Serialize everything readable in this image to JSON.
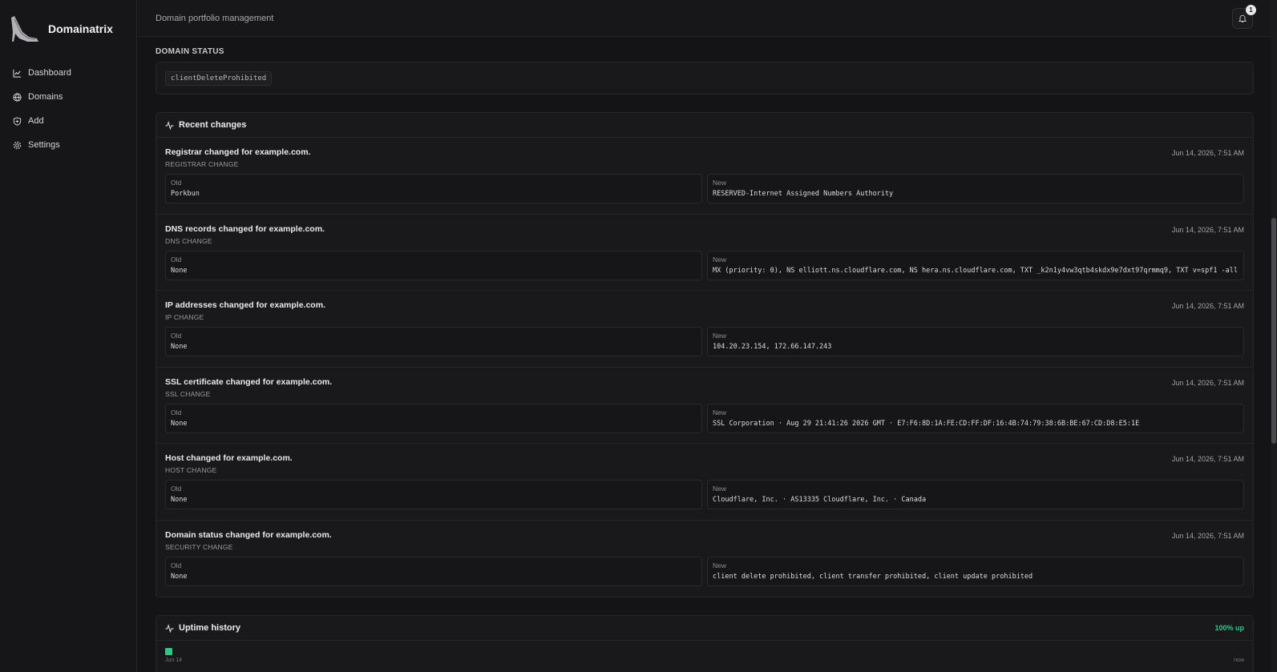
{
  "app": {
    "name": "Domainatrix"
  },
  "sidebar": {
    "items": [
      {
        "label": "Dashboard",
        "icon": "chart-line-icon"
      },
      {
        "label": "Domains",
        "icon": "globe-icon"
      },
      {
        "label": "Add",
        "icon": "shield-plus-icon"
      },
      {
        "label": "Settings",
        "icon": "gear-icon"
      }
    ]
  },
  "header": {
    "title": "Domain portfolio management",
    "notifications_count": "1"
  },
  "domain_status": {
    "heading": "DOMAIN STATUS",
    "chip": "clientDeleteProhibited"
  },
  "recent_changes": {
    "title": "Recent changes",
    "old_label": "Old",
    "new_label": "New",
    "items": [
      {
        "title": "Registrar changed for example.com.",
        "type": "REGISTRAR CHANGE",
        "time": "Jun 14, 2026, 7:51 AM",
        "old": "Porkbun",
        "new": "RESERVED-Internet Assigned Numbers Authority"
      },
      {
        "title": "DNS records changed for example.com.",
        "type": "DNS CHANGE",
        "time": "Jun 14, 2026, 7:51 AM",
        "old": "None",
        "new": "MX (priority: 0), NS elliott.ns.cloudflare.com, NS hera.ns.cloudflare.com, TXT _k2n1y4vw3qtb4skdx9e7dxt97qrmmq9, TXT v=spf1 -all"
      },
      {
        "title": "IP addresses changed for example.com.",
        "type": "IP CHANGE",
        "time": "Jun 14, 2026, 7:51 AM",
        "old": "None",
        "new": "104.20.23.154, 172.66.147.243"
      },
      {
        "title": "SSL certificate changed for example.com.",
        "type": "SSL CHANGE",
        "time": "Jun 14, 2026, 7:51 AM",
        "old": "None",
        "new": "SSL Corporation · Aug 29 21:41:26 2026 GMT · E7:F6:8D:1A:FE:CD:FF:DF:16:4B:74:79:38:6B:BE:67:CD:D8:E5:1E"
      },
      {
        "title": "Host changed for example.com.",
        "type": "HOST CHANGE",
        "time": "Jun 14, 2026, 7:51 AM",
        "old": "None",
        "new": "Cloudflare, Inc. · AS13335 Cloudflare, Inc. · Canada"
      },
      {
        "title": "Domain status changed for example.com.",
        "type": "SECURITY CHANGE",
        "time": "Jun 14, 2026, 7:51 AM",
        "old": "None",
        "new": "client delete prohibited, client transfer prohibited, client update prohibited"
      }
    ]
  },
  "uptime": {
    "title": "Uptime history",
    "percent": "100% up",
    "start_label": "Jun 14",
    "end_label": "now"
  },
  "colors": {
    "accent_green": "#34c486",
    "background": "#141416"
  }
}
